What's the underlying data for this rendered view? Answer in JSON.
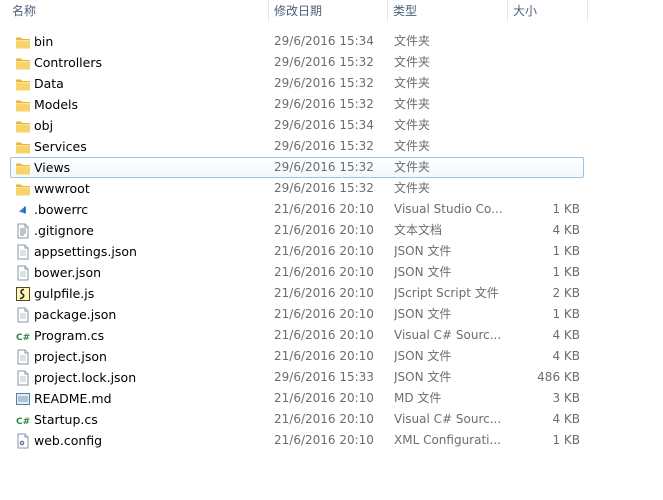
{
  "columns": {
    "name": "名称",
    "date": "修改日期",
    "type": "类型",
    "size": "大小"
  },
  "rows": [
    {
      "name": "bin",
      "date": "29/6/2016 15:34",
      "type": "文件夹",
      "size": "",
      "icon": "folder-icon"
    },
    {
      "name": "Controllers",
      "date": "29/6/2016 15:32",
      "type": "文件夹",
      "size": "",
      "icon": "folder-icon"
    },
    {
      "name": "Data",
      "date": "29/6/2016 15:32",
      "type": "文件夹",
      "size": "",
      "icon": "folder-icon"
    },
    {
      "name": "Models",
      "date": "29/6/2016 15:32",
      "type": "文件夹",
      "size": "",
      "icon": "folder-icon"
    },
    {
      "name": "obj",
      "date": "29/6/2016 15:34",
      "type": "文件夹",
      "size": "",
      "icon": "folder-icon"
    },
    {
      "name": "Services",
      "date": "29/6/2016 15:32",
      "type": "文件夹",
      "size": "",
      "icon": "folder-icon"
    },
    {
      "name": "Views",
      "date": "29/6/2016 15:32",
      "type": "文件夹",
      "size": "",
      "icon": "folder-icon",
      "selected": true
    },
    {
      "name": "wwwroot",
      "date": "29/6/2016 15:32",
      "type": "文件夹",
      "size": "",
      "icon": "folder-icon"
    },
    {
      "name": ".bowerrc",
      "date": "21/6/2016 20:10",
      "type": "Visual Studio Co...",
      "size": "1 KB",
      "icon": "visual-studio-icon"
    },
    {
      "name": ".gitignore",
      "date": "21/6/2016 20:10",
      "type": "文本文档",
      "size": "4 KB",
      "icon": "text-file-icon"
    },
    {
      "name": "appsettings.json",
      "date": "21/6/2016 20:10",
      "type": "JSON 文件",
      "size": "1 KB",
      "icon": "file-icon"
    },
    {
      "name": "bower.json",
      "date": "21/6/2016 20:10",
      "type": "JSON 文件",
      "size": "1 KB",
      "icon": "file-icon"
    },
    {
      "name": "gulpfile.js",
      "date": "21/6/2016 20:10",
      "type": "JScript Script 文件",
      "size": "2 KB",
      "icon": "script-icon"
    },
    {
      "name": "package.json",
      "date": "21/6/2016 20:10",
      "type": "JSON 文件",
      "size": "1 KB",
      "icon": "file-icon"
    },
    {
      "name": "Program.cs",
      "date": "21/6/2016 20:10",
      "type": "Visual C# Sourc...",
      "size": "4 KB",
      "icon": "csharp-icon"
    },
    {
      "name": "project.json",
      "date": "21/6/2016 20:10",
      "type": "JSON 文件",
      "size": "4 KB",
      "icon": "file-icon"
    },
    {
      "name": "project.lock.json",
      "date": "29/6/2016 15:33",
      "type": "JSON 文件",
      "size": "486 KB",
      "icon": "file-icon"
    },
    {
      "name": "README.md",
      "date": "21/6/2016 20:10",
      "type": "MD 文件",
      "size": "3 KB",
      "icon": "markdown-icon"
    },
    {
      "name": "Startup.cs",
      "date": "21/6/2016 20:10",
      "type": "Visual C# Sourc...",
      "size": "4 KB",
      "icon": "csharp-icon"
    },
    {
      "name": "web.config",
      "date": "21/6/2016 20:10",
      "type": "XML Configurati...",
      "size": "1 KB",
      "icon": "config-icon"
    }
  ]
}
